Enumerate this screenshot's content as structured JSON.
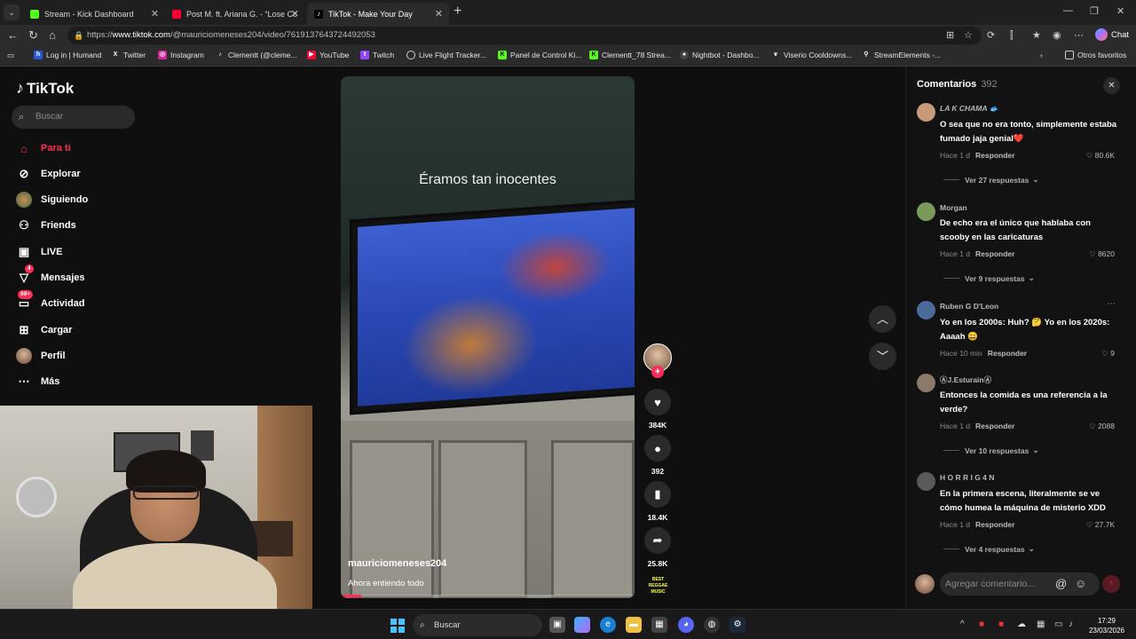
{
  "browser": {
    "tabs": [
      {
        "title": "Stream - Kick Dashboard",
        "active": false,
        "favicon_color": "#53fc18"
      },
      {
        "title": "Post M. ft. Ariana G. - “Lose Contr",
        "active": false,
        "favicon_color": "#ff0033"
      },
      {
        "title": "TikTok - Make Your Day",
        "active": true,
        "favicon_color": "#000000"
      }
    ],
    "url_prefix": "https://",
    "url_host": "www.tiktok.com",
    "url_path": "/@mauriciomeneses204/video/7619137643724492053",
    "chat_label": "Chat",
    "bookmarks": [
      "Log in | Humand",
      "Twitter",
      "Instagram",
      "Clementt (@cleme...",
      "YouTube",
      "Twitch",
      "Live Flight Tracker...",
      "Panel de Control Ki...",
      "Clementt_78 Strea...",
      "Nightbot - Dashbo...",
      "Viserio Cooldowns...",
      "StreamElements -..."
    ],
    "other_bookmarks": "Otros favoritos"
  },
  "tiktok": {
    "logo": "TikTok",
    "search_placeholder": "Buscar",
    "nav": [
      {
        "label": "Para ti",
        "icon": "home-icon",
        "active": true
      },
      {
        "label": "Explorar",
        "icon": "compass-icon"
      },
      {
        "label": "Siguiendo",
        "icon": "following-avatar-icon"
      },
      {
        "label": "Friends",
        "icon": "friends-icon"
      },
      {
        "label": "LIVE",
        "icon": "live-icon"
      },
      {
        "label": "Mensajes",
        "icon": "messages-icon",
        "badge": "4"
      },
      {
        "label": "Actividad",
        "icon": "activity-icon",
        "badge": "99+"
      },
      {
        "label": "Cargar",
        "icon": "upload-icon"
      },
      {
        "label": "Perfil",
        "icon": "profile-avatar-icon"
      },
      {
        "label": "Más",
        "icon": "more-icon"
      }
    ],
    "video": {
      "caption": "Éramos tan inocentes",
      "author": "mauriciomeneses204",
      "description": "Ahora entiendo todo",
      "progress": 0.07
    },
    "actions": {
      "likes": "384K",
      "comments": "392",
      "saves": "18.4K",
      "shares": "25.8K",
      "music_label": "BEST REGGAE MUSIC"
    },
    "comments_panel": {
      "title": "Comentarios",
      "count": "392",
      "input_placeholder": "Agregar comentario...",
      "reply_label": "Responder",
      "comments": [
        {
          "user": "LA K CHAMA 🐟",
          "text": "O sea que no era tonto, simplemente estaba fumado jaja genial❤️",
          "time": "Hace 1 d",
          "likes": "80.6K",
          "more": "Ver 27 respuestas",
          "avatar_color": "#c79a7a"
        },
        {
          "user": "Morgan",
          "text": "De echo era el único que hablaba con scooby en las caricaturas",
          "time": "Hace 1 d",
          "likes": "8620",
          "more": "Ver 9 respuestas",
          "avatar_color": "#7a9a5a"
        },
        {
          "user": "Ruben G D'Leon",
          "text": "Yo en los 2000s: Huh? 🤔 Yo en los 2020s: Aaaah 😄",
          "time": "Hace 10 min",
          "likes": "9",
          "more": "",
          "avatar_color": "#4a6a9a"
        },
        {
          "user": "ⒶJ.EsturainⒶ",
          "text": "Entonces la comida es una referencia a la verde?",
          "time": "Hace 1 d",
          "likes": "2088",
          "more": "Ver 10 respuestas",
          "avatar_color": "#8a7a6a"
        },
        {
          "user": "H O R R I G 4 N",
          "text": "En la primera escena, literalmente se ve cómo humea la máquina de misterio XDD",
          "time": "Hace 1 d",
          "likes": "27.7K",
          "more": "Ver 4 respuestas",
          "avatar_color": "#5a5a5a"
        }
      ]
    }
  },
  "taskbar": {
    "search_placeholder": "Buscar",
    "time": "17:29",
    "date": "23/03/2026"
  }
}
